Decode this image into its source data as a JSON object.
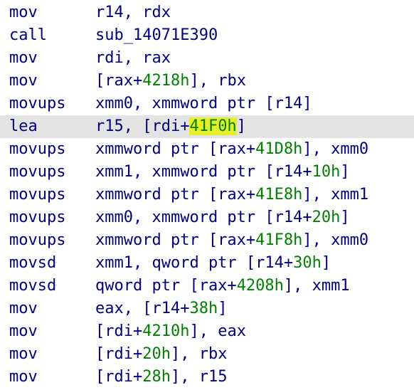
{
  "colors": {
    "text": "#000080",
    "number": "#008000",
    "selection_bg": "#e3e3e3",
    "highlight_bg": "#e6f029"
  },
  "listing": [
    {
      "mnemonic": "mov",
      "operands": [
        {
          "t": "r14, rdx"
        }
      ]
    },
    {
      "mnemonic": "call",
      "operands": [
        {
          "t": "sub_14071E390"
        }
      ]
    },
    {
      "mnemonic": "mov",
      "operands": [
        {
          "t": "rdi, rax"
        }
      ]
    },
    {
      "mnemonic": "mov",
      "operands": [
        {
          "t": "[rax+"
        },
        {
          "t": "4218h",
          "k": "num"
        },
        {
          "t": "], rbx"
        }
      ]
    },
    {
      "mnemonic": "movups",
      "operands": [
        {
          "t": "xmm0, xmmword ptr [r14]"
        }
      ]
    },
    {
      "mnemonic": "lea",
      "selected": true,
      "operands": [
        {
          "t": "r15, [rdi+"
        },
        {
          "t": "41F0h",
          "k": "num",
          "hl": true
        },
        {
          "t": "]"
        }
      ]
    },
    {
      "mnemonic": "movups",
      "operands": [
        {
          "t": "xmmword ptr [rax+"
        },
        {
          "t": "41D8h",
          "k": "num"
        },
        {
          "t": "], xmm0"
        }
      ]
    },
    {
      "mnemonic": "movups",
      "operands": [
        {
          "t": "xmm1, xmmword ptr [r14+"
        },
        {
          "t": "10h",
          "k": "num"
        },
        {
          "t": "]"
        }
      ]
    },
    {
      "mnemonic": "movups",
      "operands": [
        {
          "t": "xmmword ptr [rax+"
        },
        {
          "t": "41E8h",
          "k": "num"
        },
        {
          "t": "], xmm1"
        }
      ]
    },
    {
      "mnemonic": "movups",
      "operands": [
        {
          "t": "xmm0, xmmword ptr [r14+"
        },
        {
          "t": "20h",
          "k": "num"
        },
        {
          "t": "]"
        }
      ]
    },
    {
      "mnemonic": "movups",
      "operands": [
        {
          "t": "xmmword ptr [rax+"
        },
        {
          "t": "41F8h",
          "k": "num"
        },
        {
          "t": "], xmm0"
        }
      ]
    },
    {
      "mnemonic": "movsd",
      "operands": [
        {
          "t": "xmm1, qword ptr [r14+"
        },
        {
          "t": "30h",
          "k": "num"
        },
        {
          "t": "]"
        }
      ]
    },
    {
      "mnemonic": "movsd",
      "operands": [
        {
          "t": "qword ptr [rax+"
        },
        {
          "t": "4208h",
          "k": "num"
        },
        {
          "t": "], xmm1"
        }
      ]
    },
    {
      "mnemonic": "mov",
      "operands": [
        {
          "t": "eax, [r14+"
        },
        {
          "t": "38h",
          "k": "num"
        },
        {
          "t": "]"
        }
      ]
    },
    {
      "mnemonic": "mov",
      "operands": [
        {
          "t": "[rdi+"
        },
        {
          "t": "4210h",
          "k": "num"
        },
        {
          "t": "], eax"
        }
      ]
    },
    {
      "mnemonic": "mov",
      "operands": [
        {
          "t": "[rdi+"
        },
        {
          "t": "20h",
          "k": "num"
        },
        {
          "t": "], rbx"
        }
      ]
    },
    {
      "mnemonic": "mov",
      "operands": [
        {
          "t": "[rdi+"
        },
        {
          "t": "28h",
          "k": "num"
        },
        {
          "t": "], r15"
        }
      ]
    }
  ]
}
